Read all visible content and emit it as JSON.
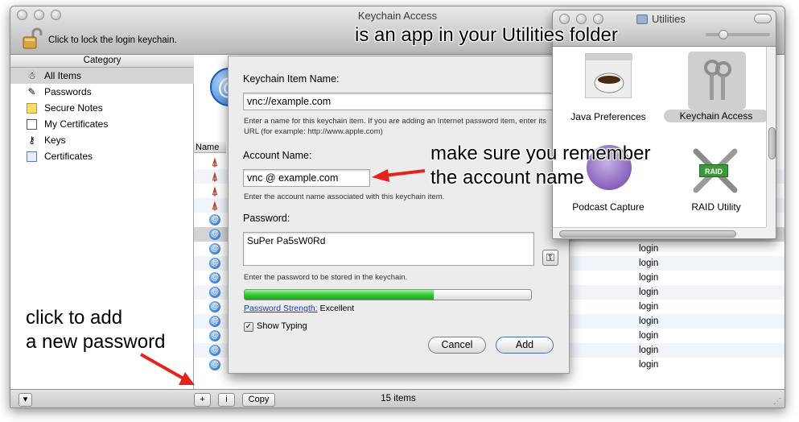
{
  "main_window": {
    "title": "Keychain Access",
    "lock_label": "Click to lock the login keychain."
  },
  "sidebar": {
    "header": "Category",
    "items": [
      {
        "label": "All Items",
        "icon": "all-items-icon",
        "selected": true
      },
      {
        "label": "Passwords",
        "icon": "passwords-icon"
      },
      {
        "label": "Secure Notes",
        "icon": "secure-notes-icon"
      },
      {
        "label": "My Certificates",
        "icon": "my-certificates-icon"
      },
      {
        "label": "Keys",
        "icon": "keys-icon"
      },
      {
        "label": "Certificates",
        "icon": "certificates-icon"
      }
    ]
  },
  "list": {
    "name_header": "Name",
    "row_keychains": [
      "login",
      "login",
      "login",
      "login",
      "login",
      "login",
      "login",
      "login",
      "login"
    ]
  },
  "bottom_bar": {
    "add_label": "+",
    "info_label": "i",
    "copy_label": "Copy",
    "item_count": "15 items"
  },
  "sheet": {
    "item_name_label": "Keychain Item Name:",
    "item_name_value": "vnc://example.com",
    "item_name_help": "Enter a name for this keychain item. If you are adding an Internet password item, enter its URL (for example: http://www.apple.com)",
    "account_label": "Account Name:",
    "account_value": "vnc @ example.com",
    "account_help": "Enter the account name associated with this keychain item.",
    "password_label": "Password:",
    "password_value": "SuPer Pa5sW0Rd",
    "password_help": "Enter the password to be stored in the keychain.",
    "strength_progress": 0.66,
    "strength_link": "Password Strength:",
    "strength_value": "Excellent",
    "show_typing_label": "Show Typing",
    "show_typing_checked": true,
    "cancel_label": "Cancel",
    "add_label": "Add"
  },
  "utilities_window": {
    "title": "Utilities",
    "apps": [
      {
        "label": "Java Preferences",
        "icon": "java-preferences-icon"
      },
      {
        "label": "Keychain Access",
        "icon": "keychain-access-icon",
        "selected": true
      },
      {
        "label": "Podcast Capture",
        "icon": "podcast-capture-icon"
      },
      {
        "label": "RAID Utility",
        "icon": "raid-utility-icon"
      }
    ],
    "raid_badge": "RAID"
  },
  "annotations": {
    "top": "is an app in your Utilities folder",
    "middle_line1": "make sure you remember",
    "middle_line2": "the account name",
    "bottom_line1": "click to add",
    "bottom_line2": "a new password"
  },
  "colors": {
    "selection": "#d4d4d4",
    "strength_bar": "#3ed13e",
    "arrow": "#e5221b",
    "link": "#1a3dbb"
  }
}
